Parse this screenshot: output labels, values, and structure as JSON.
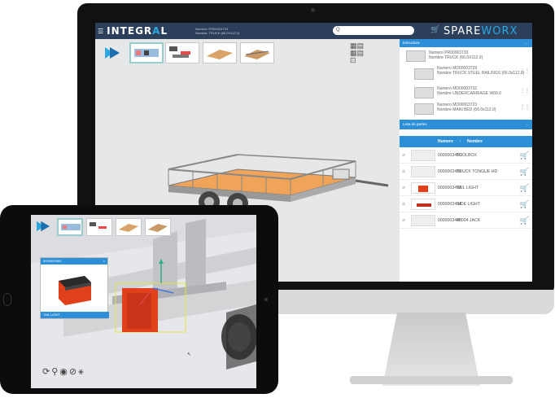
{
  "app": {
    "logo_pre": "INTEGR",
    "logo_accent": "A",
    "logo_post": "L",
    "brand_pre": "SPARE",
    "brand_accent": "WORX",
    "project_number": "Numero: PR00003733",
    "project_name": "Nombre: TRUCK (66.0X112.0)",
    "search_placeholder": "Q"
  },
  "colors": {
    "topbar": "#2b3e5a",
    "accent": "#2e8fd9",
    "logo_accent": "#2aa8e0",
    "cargo_bed": "#f0a45a",
    "part_red": "#e0401a"
  },
  "structure": {
    "title": "Estructura",
    "items": [
      {
        "number_label": "Numero",
        "number": "PR00003733",
        "name_label": "Nombre",
        "name": "TRUCK (66.0X112.0)"
      },
      {
        "number_label": "Numero",
        "number": "MD00003729",
        "name_label": "Nombre",
        "name": "TRUCK STEEL RAILINGS (66.0x112.0)"
      },
      {
        "number_label": "Numero",
        "number": "MD00003732",
        "name_label": "Nombre",
        "name": "UNDERCARRIAGE W66.0"
      },
      {
        "number_label": "Numero",
        "number": "MD00003723",
        "name_label": "Nombre",
        "name": "MAIN BED (66.0x112.0)"
      }
    ]
  },
  "parts_list": {
    "title": "Lista de partes",
    "col_number": "Numero",
    "col_name": "Nombre",
    "sort_indicator": "↑",
    "rows": [
      {
        "number": "0000003466",
        "name": "TOOLBOX"
      },
      {
        "number": "0000003491",
        "name": "TRUCK TONGUE HD"
      },
      {
        "number": "0000003493",
        "name": "TAIL LIGHT"
      },
      {
        "number": "0000003494",
        "name": "SIDE LIGHT"
      },
      {
        "number": "0000003495",
        "name": "40004 JACK"
      }
    ]
  },
  "ipad": {
    "popup_number": "0000003493",
    "popup_name": "TAIL LIGHT",
    "close": "×"
  },
  "icons": {
    "menu": "menu-icon",
    "search": "search-icon",
    "cart": "cart-icon",
    "eye": "eye-icon",
    "more": "more-icon",
    "rotate": "rotate-icon",
    "zoom": "zoom-icon"
  }
}
